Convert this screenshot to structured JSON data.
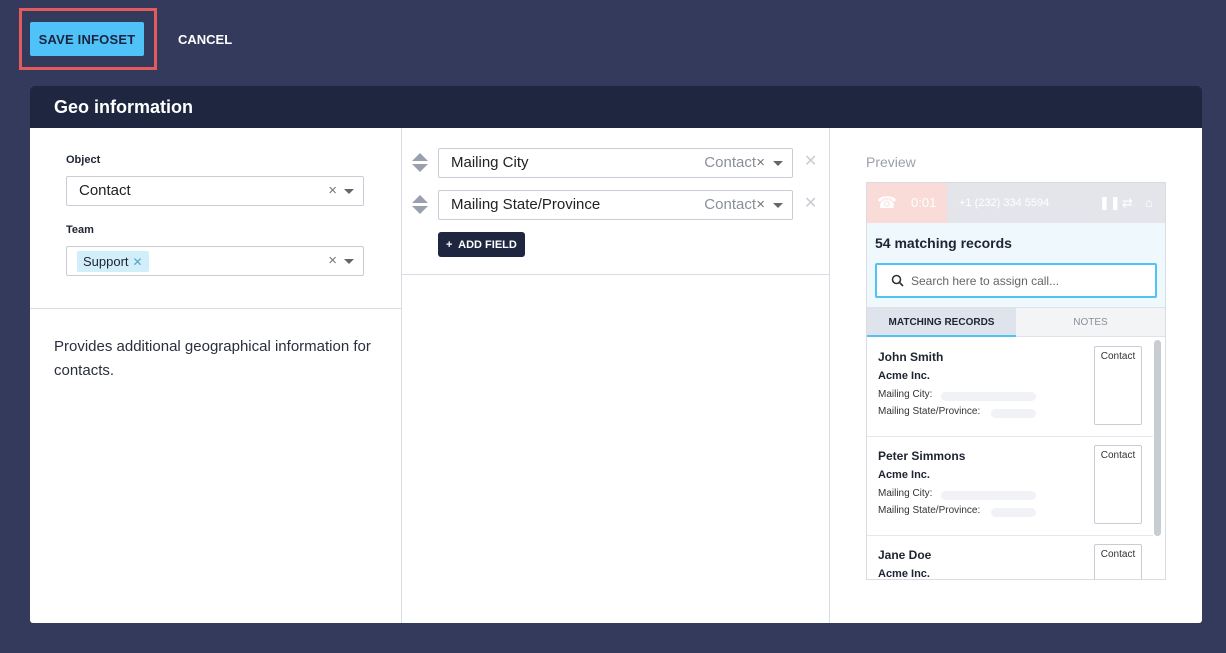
{
  "toolbar": {
    "save_label": "SAVE INFOSET",
    "cancel_label": "CANCEL"
  },
  "panel": {
    "title": "Geo information"
  },
  "config": {
    "object_label": "Object",
    "object_value": "Contact",
    "team_label": "Team",
    "team_tag": "Support",
    "description": "Provides additional geographical information for contacts."
  },
  "fields": [
    {
      "name": "Mailing City",
      "object": "Contact"
    },
    {
      "name": "Mailing State/Province",
      "object": "Contact"
    }
  ],
  "add_field_label": "ADD FIELD",
  "preview": {
    "label": "Preview",
    "call_timer": "0:01",
    "phone_number": "+1 (232) 334 5594",
    "match_title": "54 matching records",
    "search_placeholder": "Search here to assign call...",
    "tabs": [
      "MATCHING RECORDS",
      "NOTES"
    ],
    "city_label": "Mailing City:",
    "state_label": "Mailing State/Province:",
    "records": [
      {
        "name": "John Smith",
        "company": "Acme Inc.",
        "type": "Contact"
      },
      {
        "name": "Peter Simmons",
        "company": "Acme Inc.",
        "type": "Contact"
      },
      {
        "name": "Jane Doe",
        "company": "Acme Inc.",
        "type": "Contact"
      }
    ]
  },
  "colors": {
    "background": "#343a5c",
    "header": "#1f2640",
    "accent": "#4fc3f7",
    "highlight": "#e45b5b"
  }
}
